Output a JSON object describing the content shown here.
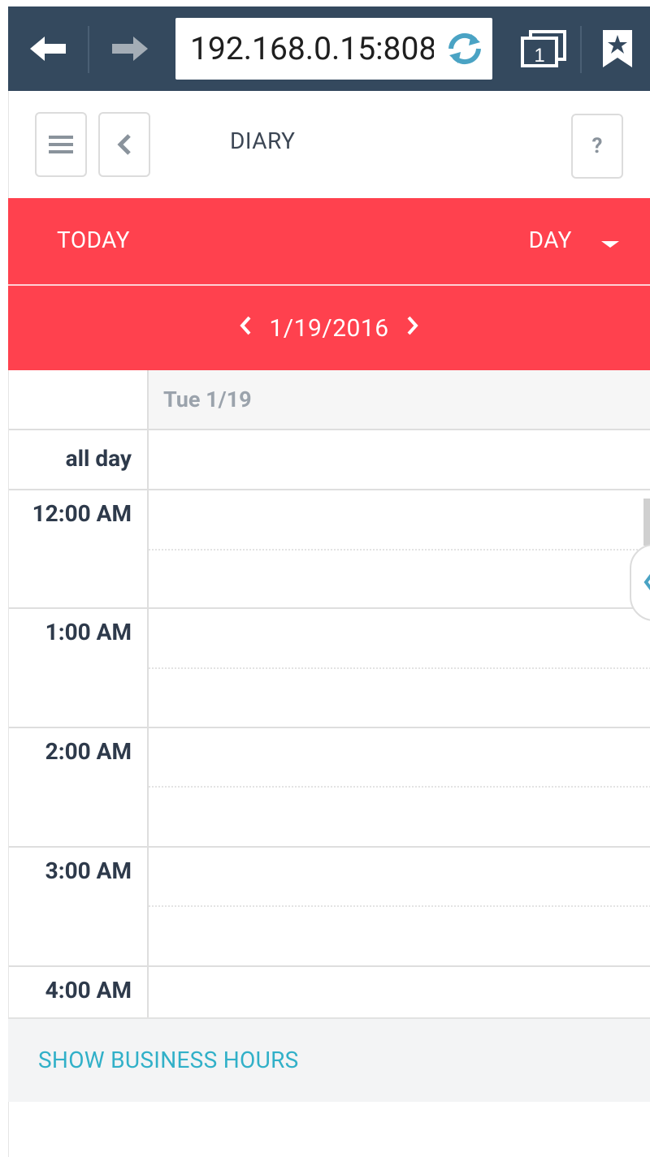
{
  "browser": {
    "url": "192.168.0.15:808",
    "tab_count": "1",
    "icons": {
      "back": "arrow-left-icon",
      "forward": "arrow-right-icon",
      "reload": "reload-icon",
      "tabs": "tabs-icon",
      "bookmark": "bookmark-star-icon"
    }
  },
  "header": {
    "title": "DIARY",
    "help_label": "?"
  },
  "toolbar": {
    "today_label": "TODAY",
    "view_label": "DAY"
  },
  "date_nav": {
    "prev": "‹",
    "date": "1/19/2016",
    "next": "›"
  },
  "calendar": {
    "day_header": "Tue 1/19",
    "all_day_label": "all day",
    "times": [
      "12:00 AM",
      "1:00 AM",
      "2:00 AM",
      "3:00 AM",
      "4:00 AM"
    ]
  },
  "footer": {
    "business_hours_label": "SHOW BUSINESS HOURS"
  },
  "colors": {
    "browser_bar": "#34495e",
    "accent_red": "#ff414e",
    "link": "#31b0c8",
    "time_text": "#2e3a4b"
  }
}
